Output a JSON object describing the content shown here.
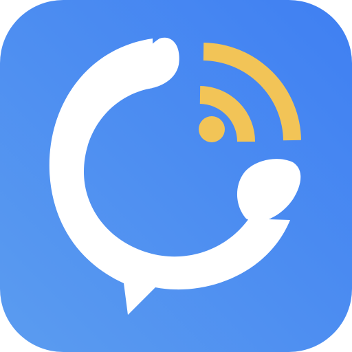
{
  "icon": {
    "name": "phone-call-wifi-chat-app-icon",
    "description_icons": [
      "phone-handset-icon",
      "speech-bubble-icon",
      "wifi-signal-icon"
    ],
    "colors": {
      "background_start": "#5b9cf0",
      "background_end": "#3f7ff2",
      "handset": "#ffffff",
      "signal": "#f2c457"
    }
  }
}
